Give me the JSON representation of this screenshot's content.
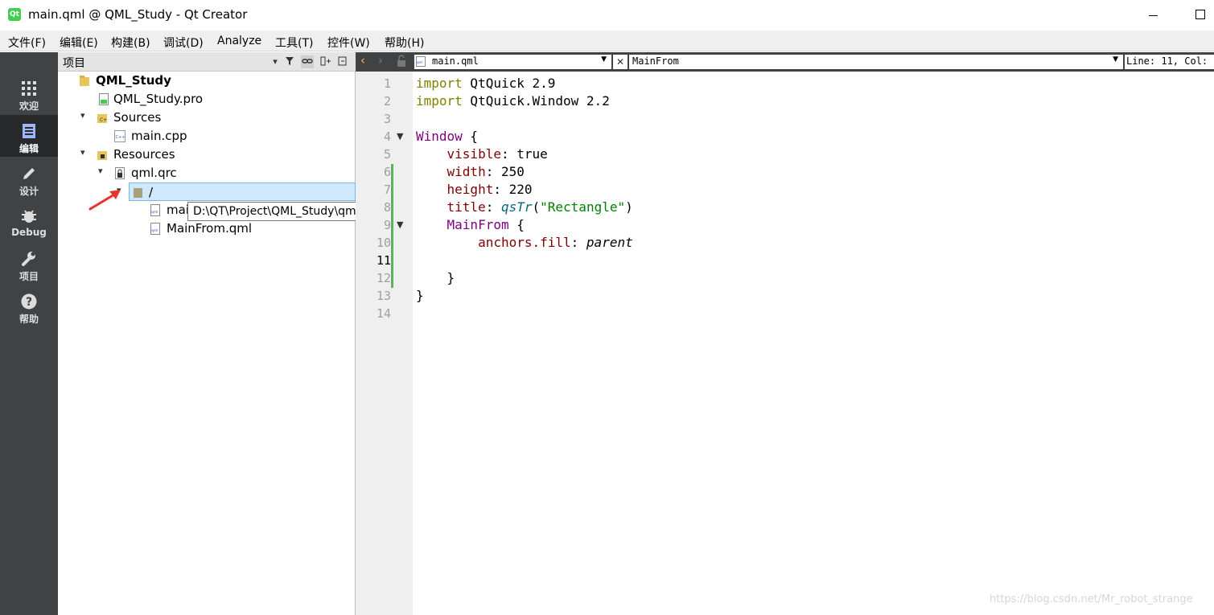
{
  "window": {
    "title": "main.qml @ QML_Study - Qt Creator",
    "app_icon": "Qt"
  },
  "menu": [
    "文件(F)",
    "编辑(E)",
    "构建(B)",
    "调试(D)",
    "Analyze",
    "工具(T)",
    "控件(W)",
    "帮助(H)"
  ],
  "modes": [
    {
      "label": "欢迎",
      "icon": "welcome-grid-icon"
    },
    {
      "label": "编辑",
      "icon": "edit-document-icon",
      "active": true
    },
    {
      "label": "设计",
      "icon": "design-pencil-icon"
    },
    {
      "label": "Debug",
      "icon": "debug-bug-icon"
    },
    {
      "label": "项目",
      "icon": "project-wrench-icon"
    },
    {
      "label": "帮助",
      "icon": "help-question-icon"
    }
  ],
  "projects_pane": {
    "title": "项目"
  },
  "tree": [
    {
      "label": "QML_Study",
      "arrow": "⌄",
      "icon": "project-folder-icon",
      "bold": true
    },
    {
      "label": "QML_Study.pro",
      "arrow": "",
      "icon": "pro-file-icon"
    },
    {
      "label": "Sources",
      "arrow": "⌄",
      "icon": "sources-folder-icon"
    },
    {
      "label": "main.cpp",
      "arrow": "",
      "icon": "cpp-file-icon"
    },
    {
      "label": "Resources",
      "arrow": "⌄",
      "icon": "resources-folder-icon"
    },
    {
      "label": "qml.qrc",
      "arrow": "⌄",
      "icon": "qrc-file-icon"
    },
    {
      "label": "/",
      "arrow": "⌄",
      "icon": "prefix-folder-icon",
      "selected": true
    },
    {
      "label": "mai",
      "arrow": "",
      "icon": "qml-file-icon"
    },
    {
      "label": "MainFrom.qml",
      "arrow": "",
      "icon": "qml-file-icon"
    }
  ],
  "tooltip": "D:\\QT\\Project\\QML_Study\\qml.qrc\\\\",
  "editor_toolbar": {
    "file": "main.qml",
    "symbol": "MainFrom",
    "position": "Line: 11, Col:"
  },
  "code": {
    "current_line": 11,
    "lines": [
      "1",
      "2",
      "3",
      "4",
      "5",
      "6",
      "7",
      "8",
      "9",
      "10",
      "11",
      "12",
      "13",
      "14"
    ]
  },
  "watermark": "https://blog.csdn.net/Mr_robot_strange",
  "colors": {
    "keyword": "#808000",
    "type": "#800080",
    "property": "#800000",
    "string": "#008000",
    "sidebar": "#404244"
  }
}
